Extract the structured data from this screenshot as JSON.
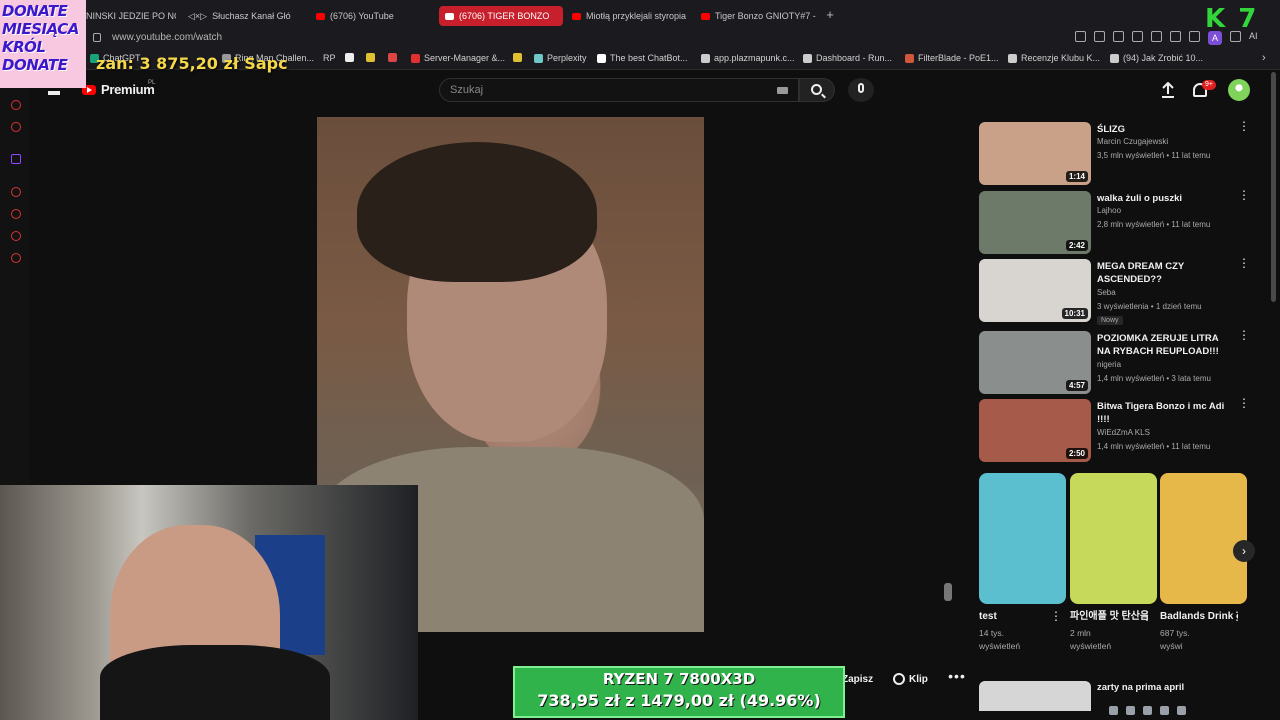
{
  "browser": {
    "tabs": [
      {
        "label": "NINSKI JEDZIE PO NOV",
        "active": false
      },
      {
        "label": "Słuchasz Kanał Głó",
        "active": false
      },
      {
        "label": "(6706) YouTube",
        "active": false
      },
      {
        "label": "(6706) TIGER BONZO",
        "active": true
      },
      {
        "label": "Miotłą przyklejali styropia",
        "active": false
      },
      {
        "label": "Tiger Bonzo GNIOTY#7 - c",
        "active": false
      }
    ],
    "new_tab": "+",
    "url": "www.youtube.com/watch",
    "profile_letter": "A",
    "ai_label": "AI",
    "bookmarks": [
      {
        "label": "ChatGPT",
        "color": "#1aa37a"
      },
      {
        "label": "Ring Man Challen...",
        "color": "#999999"
      },
      {
        "label": "RP",
        "color": "#6b6bd6"
      },
      {
        "label": "Server-Manager &...",
        "color": "#e03030"
      },
      {
        "label": "Perplexity",
        "color": "#6fc7c7"
      },
      {
        "label": "The best ChatBot...",
        "color": "#ffffff"
      },
      {
        "label": "app.plazmapunk.c...",
        "color": "#cccccc"
      },
      {
        "label": "Dashboard - Run...",
        "color": "#cccccc"
      },
      {
        "label": "FilterBlade - PoE1...",
        "color": "#d0573a"
      },
      {
        "label": "Recenzje Klubu K...",
        "color": "#cccccc"
      },
      {
        "label": "(94) Jak Zrobić 10...",
        "color": "#cccccc"
      }
    ]
  },
  "overlay": {
    "donate_lines": [
      "DONATE",
      "MIESIĄCA",
      "KRÓL",
      "DONATE"
    ],
    "donate_amount": "zan: 3 875,20 zł Sapc",
    "corner_badge": "K 7",
    "promo_title": "RYZEN 7 7800X3D",
    "promo_price": "738,95 zł z 1479,00 zł (49.96%)"
  },
  "youtube": {
    "logo_text": "Premium",
    "logo_region": "PL",
    "search_placeholder": "Szukaj",
    "notification_count": "9+",
    "actions": {
      "save": "Zapisz",
      "clip": "Klip",
      "more": "•••"
    },
    "recommendations": [
      {
        "title": "ŚLIZG",
        "channel": "Marcin Czugajewski",
        "meta": "3,5 mln wyświetleń • 11 lat temu",
        "duration": "1:14",
        "badge": "",
        "thumb_color": "#c9a088"
      },
      {
        "title": "walka żuli o puszki",
        "channel": "Lajhoo",
        "meta": "2,8 mln wyświetleń • 11 lat temu",
        "duration": "2:42",
        "badge": "",
        "thumb_color": "#6d7a6a"
      },
      {
        "title": "MEGA DREAM CZY ASCENDED??",
        "channel": "Seba",
        "meta": "3 wyświetlenia • 1 dzień temu",
        "duration": "10:31",
        "badge": "Nowy",
        "thumb_color": "#d8d4cf"
      },
      {
        "title": "POZIOMKA ZERUJE LITRA NA RYBACH REUPLOAD!!!",
        "channel": "nigeria",
        "meta": "1,4 mln wyświetleń • 3 lata temu",
        "duration": "4:57",
        "badge": "",
        "thumb_color": "#8a8e8c"
      },
      {
        "title": "Bitwa Tigera Bonzo i mc Adi !!!!",
        "channel": "WiEdZmA KLS",
        "meta": "1,4 mln wyświetleń • 11 lat temu",
        "duration": "2:50",
        "badge": "",
        "thumb_color": "#a55a4a"
      }
    ],
    "shorts": [
      {
        "title": "test",
        "views_1": "14 tys.",
        "views_2": "wyświetleń",
        "color": "#5bbfcf"
      },
      {
        "title": "파인애플 맛 탄산음료 탑...",
        "views_1": "2 mln",
        "views_2": "wyświetleń",
        "color": "#c7d95a"
      },
      {
        "title": "Badlands Drink of the...",
        "views_1": "687 tys.",
        "views_2": "wyświ",
        "color": "#e6b84a"
      }
    ],
    "partial_rec_title": "zarty na prima april"
  }
}
